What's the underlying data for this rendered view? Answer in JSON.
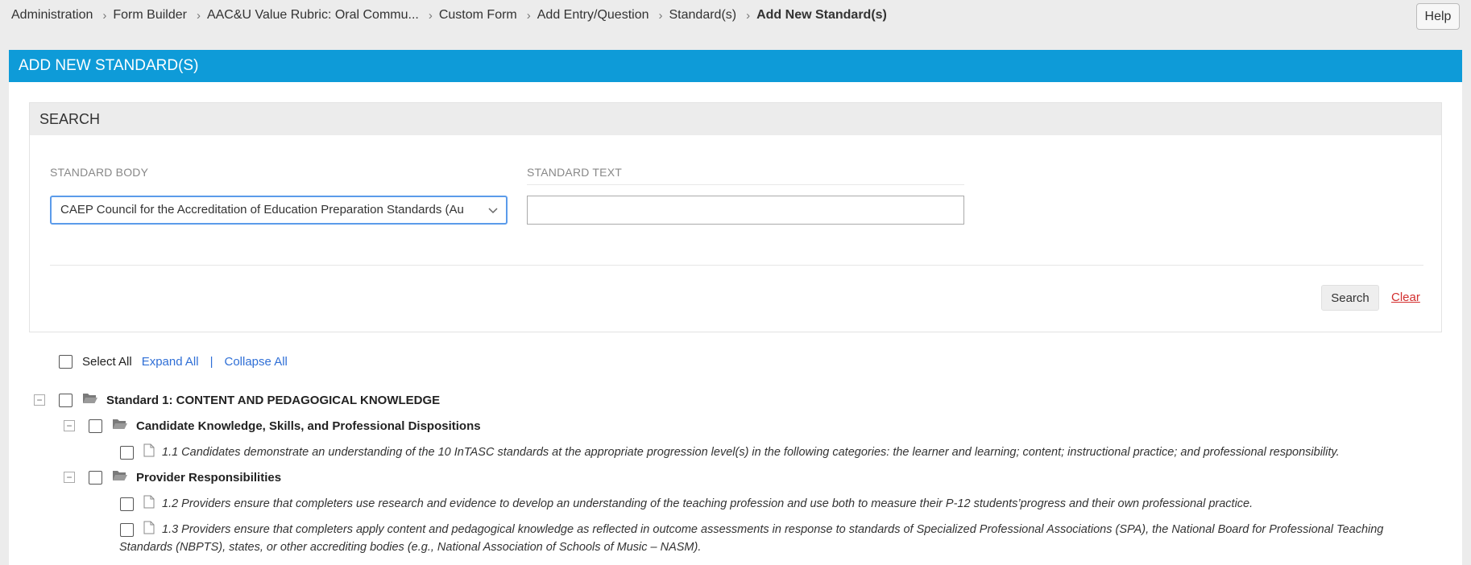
{
  "breadcrumb": [
    {
      "label": "Administration"
    },
    {
      "label": "Form Builder"
    },
    {
      "label": "AAC&U Value Rubric: Oral Commu..."
    },
    {
      "label": "Custom Form"
    },
    {
      "label": "Add Entry/Question"
    },
    {
      "label": "Standard(s)"
    },
    {
      "label": "Add New Standard(s)"
    }
  ],
  "help_label": "Help",
  "panel_title": "ADD NEW STANDARD(S)",
  "search": {
    "header": "SEARCH",
    "standard_body_label": "STANDARD BODY",
    "standard_body_value": "CAEP Council for the Accreditation of Education Preparation Standards (Au",
    "standard_text_label": "STANDARD TEXT",
    "standard_text_value": "",
    "search_button": "Search",
    "clear_link": "Clear"
  },
  "tree_toolbar": {
    "select_all": "Select All",
    "expand_all": "Expand All",
    "separator": "|",
    "collapse_all": "Collapse All"
  },
  "tree": {
    "standard1": "Standard 1: CONTENT AND PEDAGOGICAL KNOWLEDGE",
    "group1": "Candidate Knowledge, Skills, and Professional Dispositions",
    "item1_1": "1.1 Candidates demonstrate an understanding of the 10 InTASC standards at the appropriate progression level(s) in the following categories: the learner and learning; content; instructional practice; and professional responsibility.",
    "group2": "Provider Responsibilities",
    "item1_2": "1.2 Providers ensure that completers use research and evidence to develop an understanding of the teaching profession and use both to measure their P-12 students’progress and their own professional practice.",
    "item1_3_line1": "1.3 Providers ensure that completers apply content and pedagogical knowledge as reflected in outcome assessments in response to standards of Specialized Professional Associations (SPA), the National Board for Professional Teaching",
    "item1_3_line2": "Standards (NBPTS), states, or other accrediting bodies (e.g., National Association of Schools of Music – NASM)."
  },
  "colors": {
    "header_blue": "#0e9bd8",
    "link_blue": "#2f6fd6",
    "clear_red": "#d32f2f",
    "focus_border": "#5b9bea"
  },
  "icons": {
    "toggle": "minus-square-icon",
    "folder": "folder-open-icon",
    "doc": "document-icon",
    "select": "chevron-down-icon",
    "breadcrumb_sep": "chevron-right-icon"
  }
}
